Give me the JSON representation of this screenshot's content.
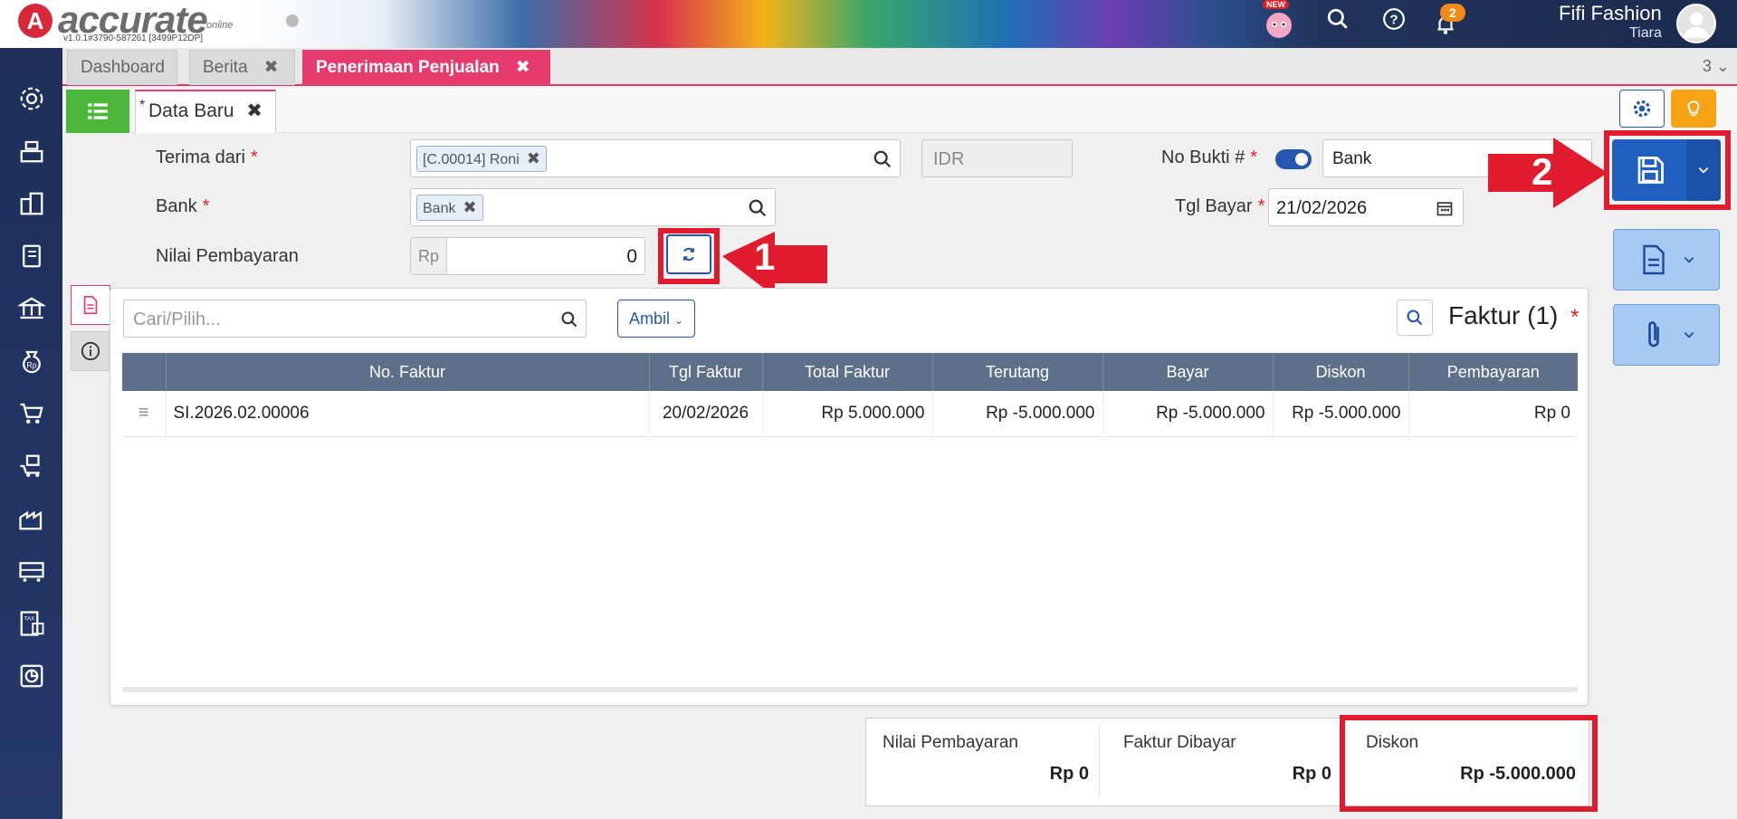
{
  "header": {
    "logo_text": "accurate",
    "logo_sub": "online",
    "version": "v1.0.1#3790-587261 [3499P12DP]",
    "new_badge": "NEW",
    "notification_count": "2",
    "company": "Fifi Fashion",
    "user": "Tiara"
  },
  "tabs": {
    "items": [
      {
        "label": "Dashboard"
      },
      {
        "label": "Berita"
      },
      {
        "label": "Penerimaan Penjualan"
      }
    ],
    "count": "3"
  },
  "form": {
    "subtab_label": "Data Baru",
    "subtab_star": "*",
    "terima_dari_label": "Terima dari",
    "terima_dari_value": "[C.00014] Roni",
    "currency": "IDR",
    "no_bukti_label": "No Bukti #",
    "no_bukti_value": "Bank",
    "bank_label": "Bank",
    "bank_value": "Bank",
    "tgl_bayar_label": "Tgl Bayar",
    "tgl_bayar_value": "21/02/2026",
    "nilai_label": "Nilai Pembayaran",
    "nilai_prefix": "Rp",
    "nilai_value": "0",
    "required_mark": "*"
  },
  "annotations": {
    "step1": "1",
    "step2": "2"
  },
  "grid": {
    "search_placeholder": "Cari/Pilih...",
    "ambil_label": "Ambil",
    "title": "Faktur (1)",
    "columns": [
      "No. Faktur",
      "Tgl Faktur",
      "Total Faktur",
      "Terutang",
      "Bayar",
      "Diskon",
      "Pembayaran"
    ],
    "rows": [
      {
        "no_faktur": "SI.2026.02.00006",
        "tgl_faktur": "20/02/2026",
        "total_faktur": "Rp 5.000.000",
        "terutang": "Rp -5.000.000",
        "bayar": "Rp -5.000.000",
        "diskon": "Rp -5.000.000",
        "pembayaran": "Rp 0"
      }
    ]
  },
  "summary": {
    "nilai_label": "Nilai Pembayaran",
    "nilai_value": "Rp 0",
    "faktur_label": "Faktur Dibayar",
    "faktur_value": "Rp 0",
    "diskon_label": "Diskon",
    "diskon_value": "Rp -5.000.000"
  },
  "colors": {
    "accent_pink": "#e63b6e",
    "primary_blue": "#1f5fc0",
    "annotation_red": "#e01b2e",
    "sidebar_navy": "#1d2f5a"
  },
  "sidebar_icons": [
    "gear-icon",
    "cash-register-icon",
    "building-icon",
    "ledger-icon",
    "bank-icon",
    "money-bag-icon",
    "cart-icon",
    "purchase-cart-icon",
    "factory-icon",
    "warehouse-icon",
    "tax-icon",
    "report-icon"
  ]
}
